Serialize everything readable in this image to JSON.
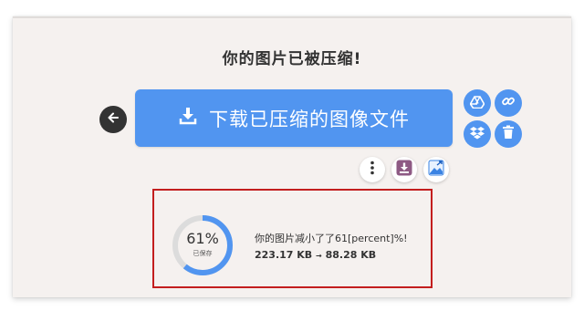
{
  "page": {
    "title": "你的图片已被压缩!"
  },
  "actions": {
    "download_label": "下载已压缩的图像文件",
    "back_icon": "arrow-left-icon",
    "download_icon": "download-icon",
    "side_icons": [
      "google-drive-icon",
      "link-icon",
      "dropbox-icon",
      "trash-icon"
    ],
    "mini_icons": [
      "more-vert-icon",
      "save-download-icon",
      "image-resize-icon"
    ]
  },
  "result": {
    "percent": "61%",
    "saved_label": "已保存",
    "message": "你的图片减小了了61[percent]%!",
    "size_before": "223.17 KB",
    "arrow": "→",
    "size_after": "88.28 KB",
    "percent_value": 61
  },
  "colors": {
    "accent": "#5195f0",
    "highlight_border": "#c31e1e",
    "card_bg": "#f5f1ef",
    "ring_track": "#dcdcdc",
    "purple": "#8e5a84"
  }
}
